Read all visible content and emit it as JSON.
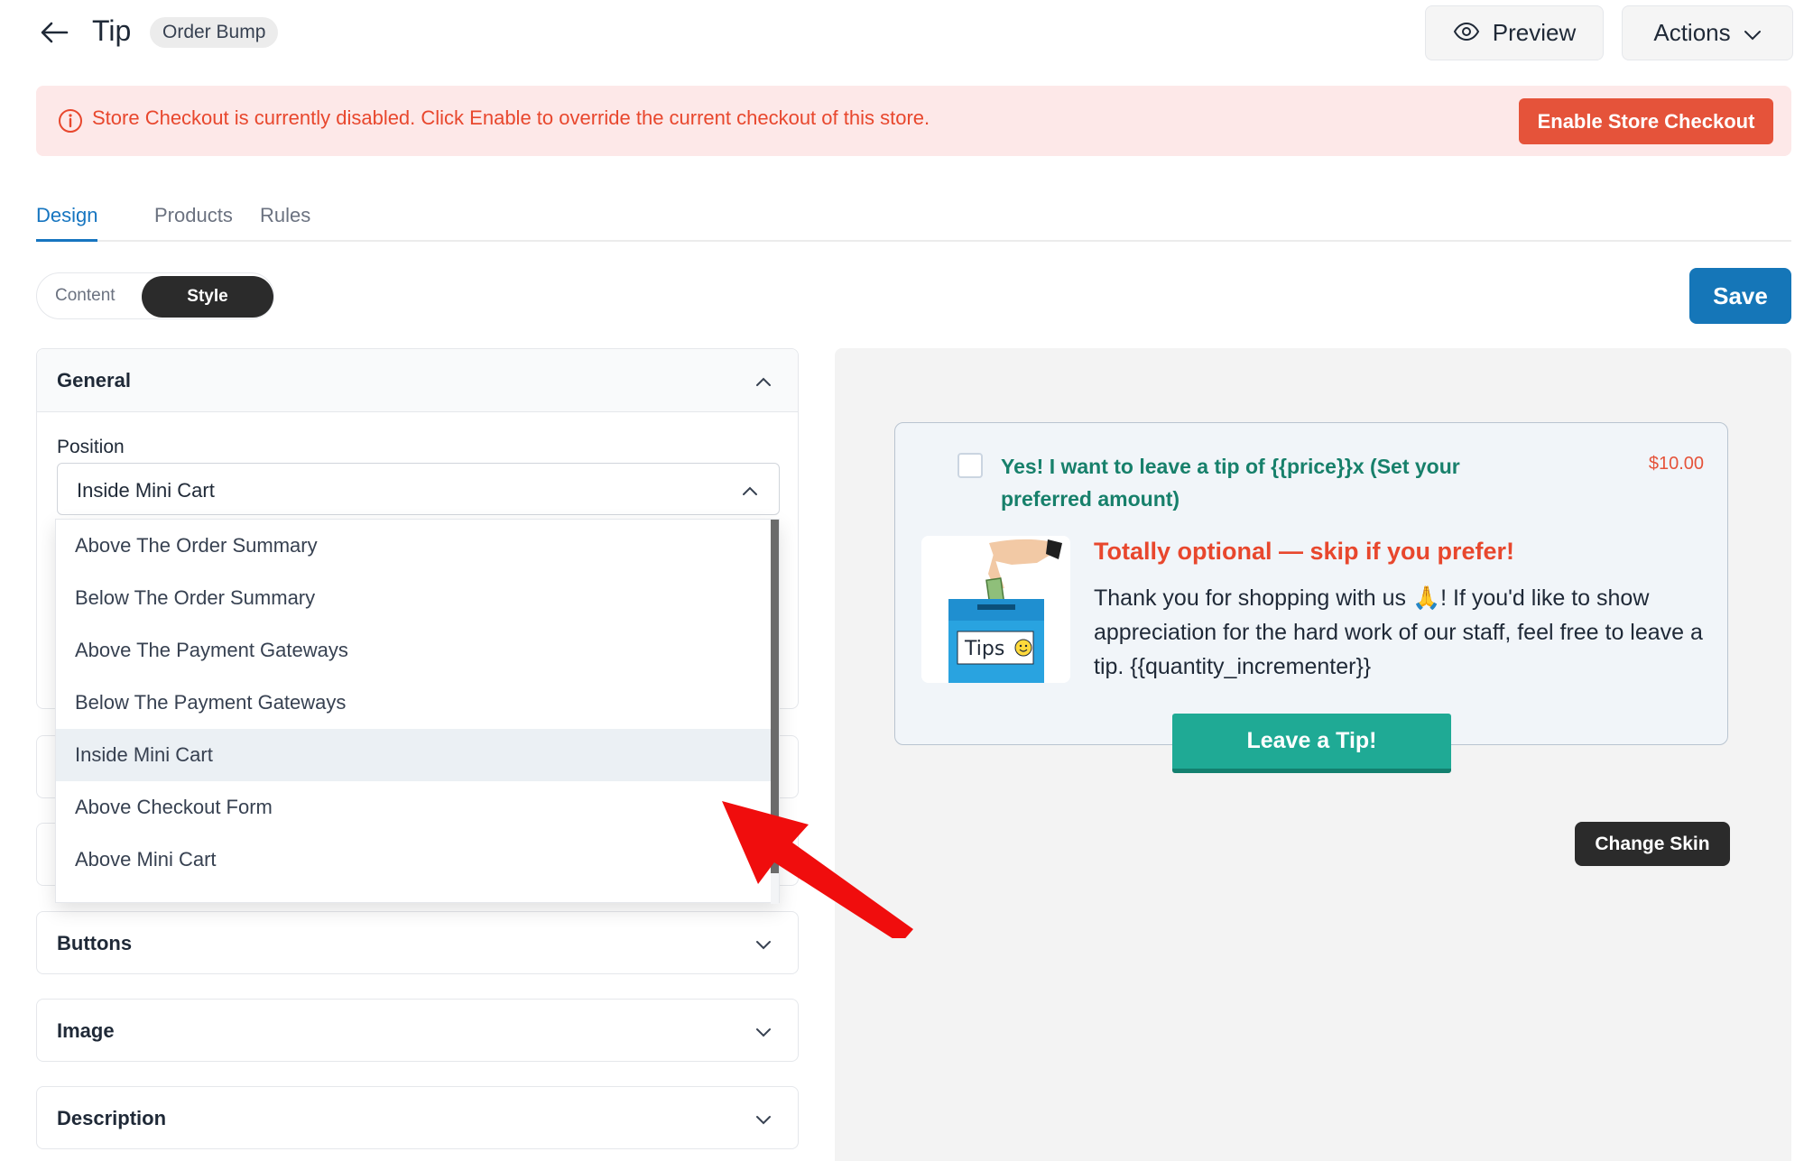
{
  "header": {
    "title": "Tip",
    "badge": "Order Bump",
    "preview_label": "Preview",
    "actions_label": "Actions"
  },
  "alert": {
    "message": "Store Checkout is currently disabled. Click Enable to override the current checkout of this store.",
    "button_label": "Enable Store Checkout"
  },
  "tabs": [
    {
      "label": "Design",
      "active": true
    },
    {
      "label": "Products",
      "active": false
    },
    {
      "label": "Rules",
      "active": false
    }
  ],
  "segment": {
    "content_label": "Content",
    "style_label": "Style",
    "selected": "Style"
  },
  "save_label": "Save",
  "panels": {
    "general": {
      "title": "General",
      "position_label": "Position",
      "position_value": "Inside Mini Cart"
    },
    "buttons": {
      "title": "Buttons"
    },
    "image": {
      "title": "Image"
    },
    "description": {
      "title": "Description"
    }
  },
  "dropdown": {
    "options": [
      "Above The Order Summary",
      "Below The Order Summary",
      "Above The Payment Gateways",
      "Below The Payment Gateways",
      "Inside Mini Cart",
      "Above Checkout Form",
      "Above Mini Cart"
    ],
    "selected": "Inside Mini Cart"
  },
  "preview": {
    "headline": "Yes! I want to leave a tip of {{price}}x (Set your preferred amount)",
    "price": "$10.00",
    "image_label": "Tips",
    "subheadline": "Totally optional — skip if you prefer!",
    "description": "Thank you for shopping with us 🙏! If you'd like to show appreciation for the hard work of our staff, feel free to leave a tip. {{quantity_incrementer}}",
    "button_label": "Leave a Tip!",
    "change_skin_label": "Change Skin"
  },
  "colors": {
    "accent": "#1576b8",
    "danger": "#e5533a",
    "teal": "#1faa95",
    "dark": "#2b2b2b"
  }
}
